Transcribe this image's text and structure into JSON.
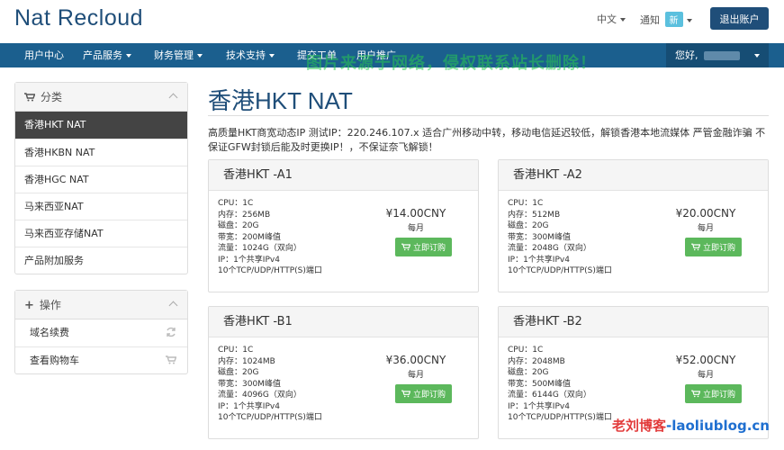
{
  "header": {
    "brand": "Nat Recloud",
    "lang": "中文",
    "notice": "通知",
    "notice_badge": "新",
    "logout": "退出账户"
  },
  "nav": {
    "items": [
      {
        "label": "用户中心",
        "dropdown": false
      },
      {
        "label": "产品服务",
        "dropdown": true
      },
      {
        "label": "财务管理",
        "dropdown": true
      },
      {
        "label": "技术支持",
        "dropdown": true
      },
      {
        "label": "提交工单",
        "dropdown": false
      },
      {
        "label": "用户推广",
        "dropdown": false
      }
    ],
    "user_greeting": "您好,"
  },
  "watermarks": {
    "top": "图片来源于网络，侵权联系站长删除！",
    "bottom_a": "老刘博客",
    "bottom_b": "-laoliublog.cn"
  },
  "sidebar": {
    "categories": {
      "title": "分类",
      "items": [
        {
          "label": "香港HKT NAT",
          "active": true
        },
        {
          "label": "香港HKBN NAT",
          "active": false
        },
        {
          "label": "香港HGC NAT",
          "active": false
        },
        {
          "label": "马来西亚NAT",
          "active": false
        },
        {
          "label": "马来西亚存储NAT",
          "active": false
        },
        {
          "label": "产品附加服务",
          "active": false
        }
      ]
    },
    "actions": {
      "title": "操作",
      "items": [
        {
          "label": "域名续费",
          "icon": "refresh-icon"
        },
        {
          "label": "查看购物车",
          "icon": "cart-icon"
        }
      ]
    }
  },
  "main": {
    "title": "香港HKT NAT",
    "description": "高质量HKT商宽动态IP 测试IP：220.246.107.x 适合广州移动中转，移动电信延迟较低，解锁香港本地流媒体 严管金融诈骗 不保证GFW封锁后能及时更换IP！，不保证奈飞解锁！",
    "buy_label": "立即订购",
    "period_label": "每月",
    "products": [
      {
        "name": "香港HKT -A1",
        "price": "¥14.00CNY",
        "specs": [
          "CPU：1C",
          "内存：256MB",
          "磁盘：20G",
          "带宽：200M峰值",
          "流量：1024G（双向）",
          "IP：1个共享IPv4",
          "10个TCP/UDP/HTTP(S)端口"
        ]
      },
      {
        "name": "香港HKT -A2",
        "price": "¥20.00CNY",
        "specs": [
          "CPU：1C",
          "内存：512MB",
          "磁盘：20G",
          "带宽：300M峰值",
          "流量：2048G（双向）",
          "IP：1个共享IPv4",
          "10个TCP/UDP/HTTP(S)端口"
        ]
      },
      {
        "name": "香港HKT -B1",
        "price": "¥36.00CNY",
        "specs": [
          "CPU：1C",
          "内存：1024MB",
          "磁盘：20G",
          "带宽：300M峰值",
          "流量：4096G（双向）",
          "IP：1个共享IPv4",
          "10个TCP/UDP/HTTP(S)端口"
        ]
      },
      {
        "name": "香港HKT -B2",
        "price": "¥52.00CNY",
        "specs": [
          "CPU：1C",
          "内存：2048MB",
          "磁盘：20G",
          "带宽：500M峰值",
          "流量：6144G（双向）",
          "IP：1个共享IPv4",
          "10个TCP/UDP/HTTP(S)端口"
        ]
      }
    ]
  },
  "colors": {
    "brand": "#1f4e79",
    "nav": "#1b5f8e",
    "buy": "#5cb85c",
    "active_item": "#444444"
  }
}
